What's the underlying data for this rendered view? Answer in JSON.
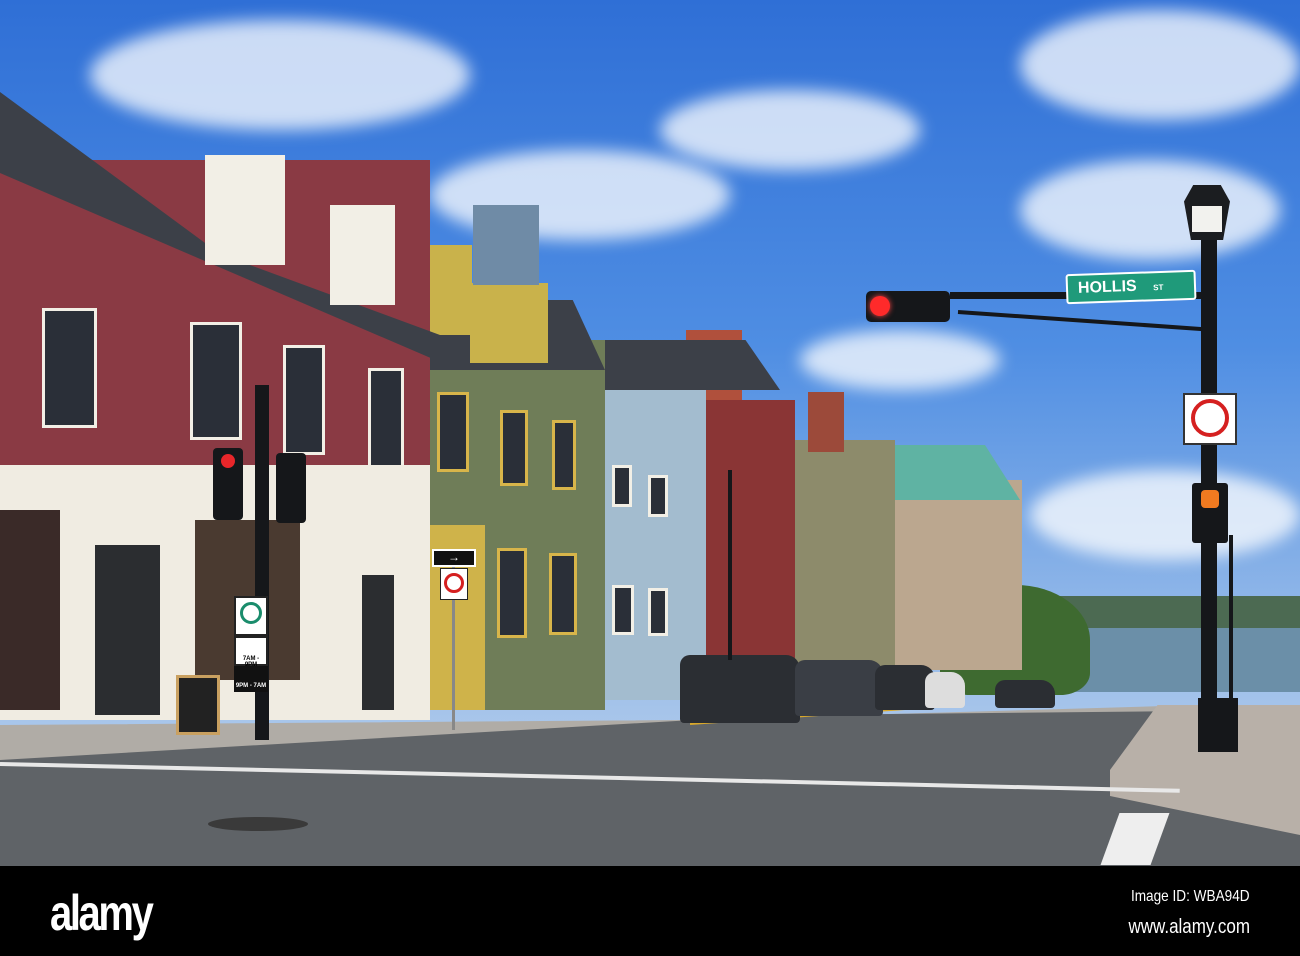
{
  "photo": {
    "street_sign": {
      "name": "HOLLIS",
      "suffix": "ST",
      "color": "#1f9a7a"
    },
    "lane_sign": {
      "times_1": "7AM - 9PM",
      "times_2": "9PM - 7AM"
    },
    "colors": {
      "sky": "#4f8ee3",
      "red_house": "#8a3a44",
      "green_house": "#6f7d58",
      "blue_house": "#a3bccf",
      "road": "#5f6367",
      "water": "#6b8fa8"
    }
  },
  "watermark": {
    "logo": "alamy",
    "image_id": "Image ID: WBA94D",
    "site": "www.alamy.com"
  }
}
